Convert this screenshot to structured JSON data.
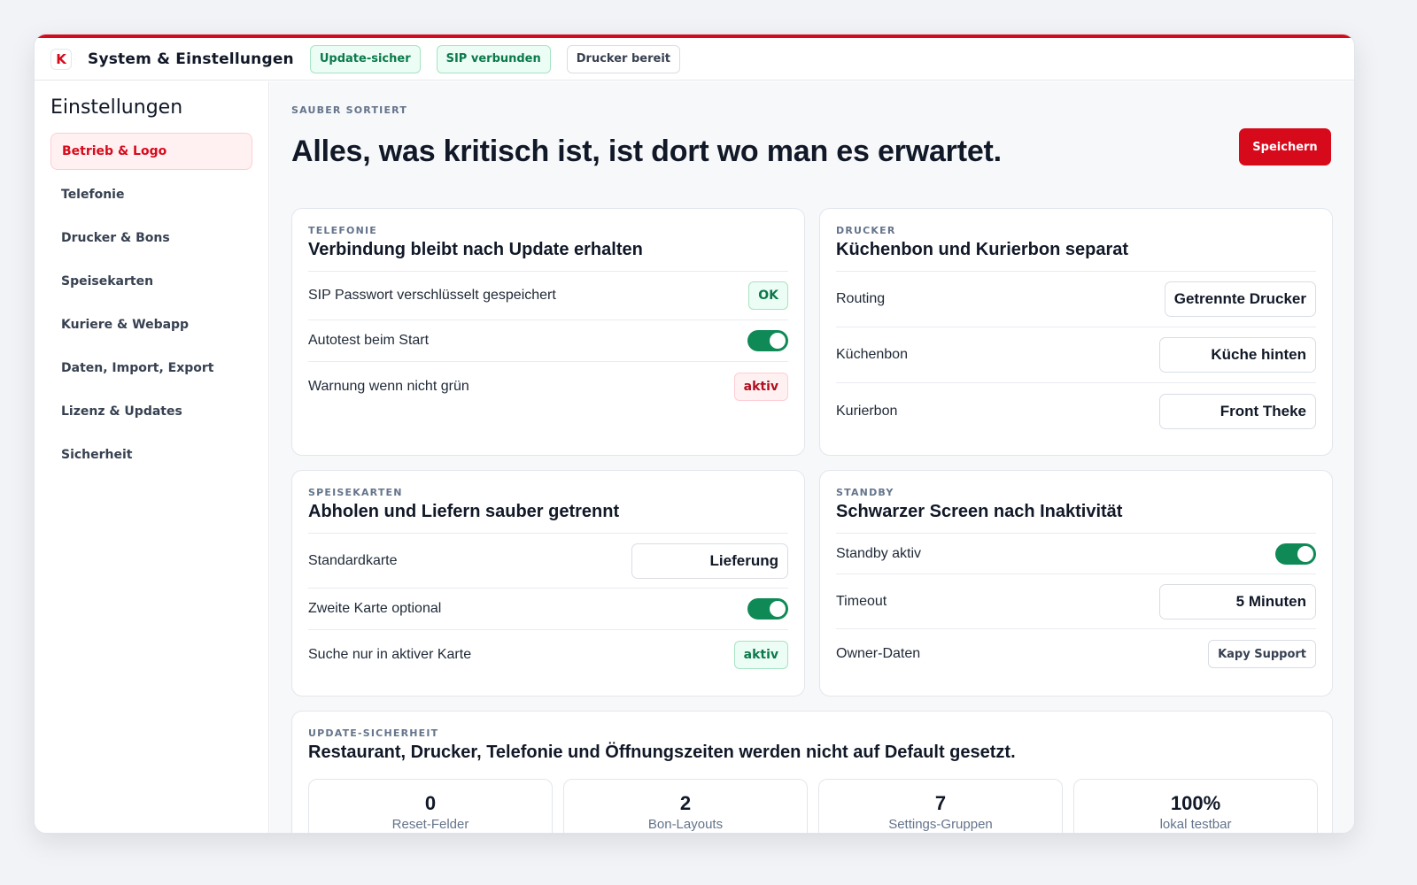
{
  "topbar": {
    "logo_letter": "K",
    "title": "System & Einstellungen",
    "badges": [
      "Update-sicher",
      "SIP verbunden",
      "Drucker bereit"
    ]
  },
  "sidebar": {
    "title": "Einstellungen",
    "items": [
      {
        "label": "Betrieb & Logo",
        "active": true
      },
      {
        "label": "Telefonie"
      },
      {
        "label": "Drucker & Bons"
      },
      {
        "label": "Speisekarten"
      },
      {
        "label": "Kuriere & Webapp"
      },
      {
        "label": "Daten, Import, Export"
      },
      {
        "label": "Lizenz & Updates"
      },
      {
        "label": "Sicherheit"
      }
    ]
  },
  "main": {
    "kicker": "SAUBER SORTIERT",
    "headline": "Alles, was kritisch ist, ist dort wo man es erwartet.",
    "save_label": "Speichern"
  },
  "cards": {
    "telefonie": {
      "kicker": "TELEFONIE",
      "title": "Verbindung bleibt nach Update erhalten",
      "rows": [
        {
          "label": "SIP Passwort verschlüsselt gespeichert",
          "value": "OK"
        },
        {
          "label": "Autotest beim Start",
          "toggle": true
        },
        {
          "label": "Warnung wenn nicht grün",
          "value": "aktiv"
        }
      ]
    },
    "drucker": {
      "kicker": "DRUCKER",
      "title": "Küchenbon und Kurierbon separat",
      "rows": [
        {
          "label": "Routing",
          "value": "Getrennte Drucker"
        },
        {
          "label": "Küchenbon",
          "value": "Küche hinten"
        },
        {
          "label": "Kurierbon",
          "value": "Front Theke"
        }
      ]
    },
    "speisekarten": {
      "kicker": "SPEISEKARTEN",
      "title": "Abholen und Liefern sauber getrennt",
      "rows": [
        {
          "label": "Standardkarte",
          "value": "Lieferung"
        },
        {
          "label": "Zweite Karte optional",
          "toggle": true
        },
        {
          "label": "Suche nur in aktiver Karte",
          "value": "aktiv"
        }
      ]
    },
    "standby": {
      "kicker": "STANDBY",
      "title": "Schwarzer Screen nach Inaktivität",
      "rows": [
        {
          "label": "Standby aktiv",
          "toggle": true
        },
        {
          "label": "Timeout",
          "value": "5 Minuten"
        },
        {
          "label": "Owner-Daten",
          "value": "Kapy Support"
        }
      ]
    },
    "update": {
      "kicker": "UPDATE-SICHERHEIT",
      "title": "Restaurant, Drucker, Telefonie und Öffnungszeiten werden nicht auf Default gesetzt.",
      "stats": [
        {
          "value": "0",
          "label": "Reset-Felder"
        },
        {
          "value": "2",
          "label": "Bon-Layouts"
        },
        {
          "value": "7",
          "label": "Settings-Gruppen"
        },
        {
          "value": "100%",
          "label": "lokal testbar"
        }
      ]
    }
  },
  "colors": {
    "brand_red": "#d70a1c",
    "success_green": "#0f8a57",
    "success_bg": "#ecfdf5",
    "danger_bg": "#fff1f2"
  }
}
